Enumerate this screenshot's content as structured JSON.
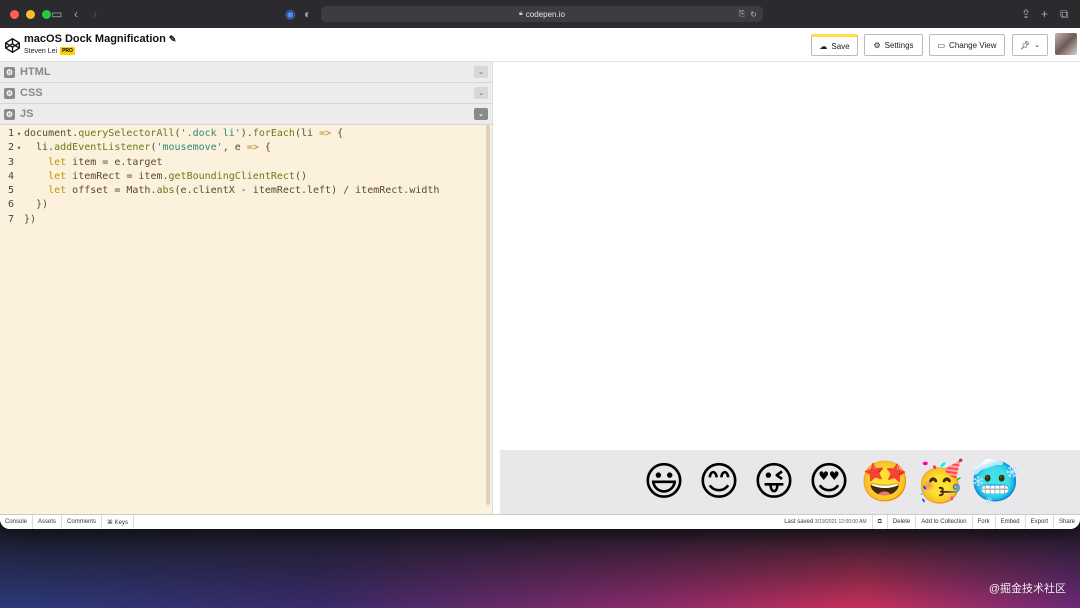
{
  "browser": {
    "url": "codepen.io"
  },
  "pen": {
    "title": "macOS Dock Magnification",
    "author": "Steven Lei",
    "badge": "PRO"
  },
  "header_buttons": {
    "save": "Save",
    "settings": "Settings",
    "change_view": "Change View"
  },
  "panels": {
    "html": "HTML",
    "css": "CSS",
    "js": "JS"
  },
  "code_lines": [
    {
      "num": "1",
      "fold": "▾",
      "text": "document.querySelectorAll('.dock li').forEach(li => {"
    },
    {
      "num": "2",
      "fold": "▾",
      "text": "  li.addEventListener('mousemove', e => {"
    },
    {
      "num": "3",
      "fold": "",
      "text": "    let item = e.target"
    },
    {
      "num": "4",
      "fold": "",
      "text": "    let itemRect = item.getBoundingClientRect()"
    },
    {
      "num": "5",
      "fold": "",
      "text": "    let offset = Math.abs(e.clientX - itemRect.left) / itemRect.width"
    },
    {
      "num": "6",
      "fold": "",
      "text": "  })"
    },
    {
      "num": "7",
      "fold": "",
      "text": "})"
    }
  ],
  "dock_emojis": [
    "😃",
    "😊",
    "😜",
    "😍",
    "🤩",
    "🥳",
    "🥶"
  ],
  "footer": {
    "console": "Console",
    "assets": "Assets",
    "comments": "Comments",
    "keys": "⌘ Keys",
    "last_saved_label": "Last saved",
    "last_saved_time": "3/19/2021 12:00:00 AM",
    "delete": "Delete",
    "add_to_collection": "Add to Collection",
    "fork": "Fork",
    "embed": "Embed",
    "export": "Export",
    "share": "Share"
  },
  "watermark": "@掘金技术社区",
  "colors": {
    "editor_bg": "#fcf1dd",
    "save_accent": "#ffdd40",
    "pro_badge": "#fcd000"
  }
}
